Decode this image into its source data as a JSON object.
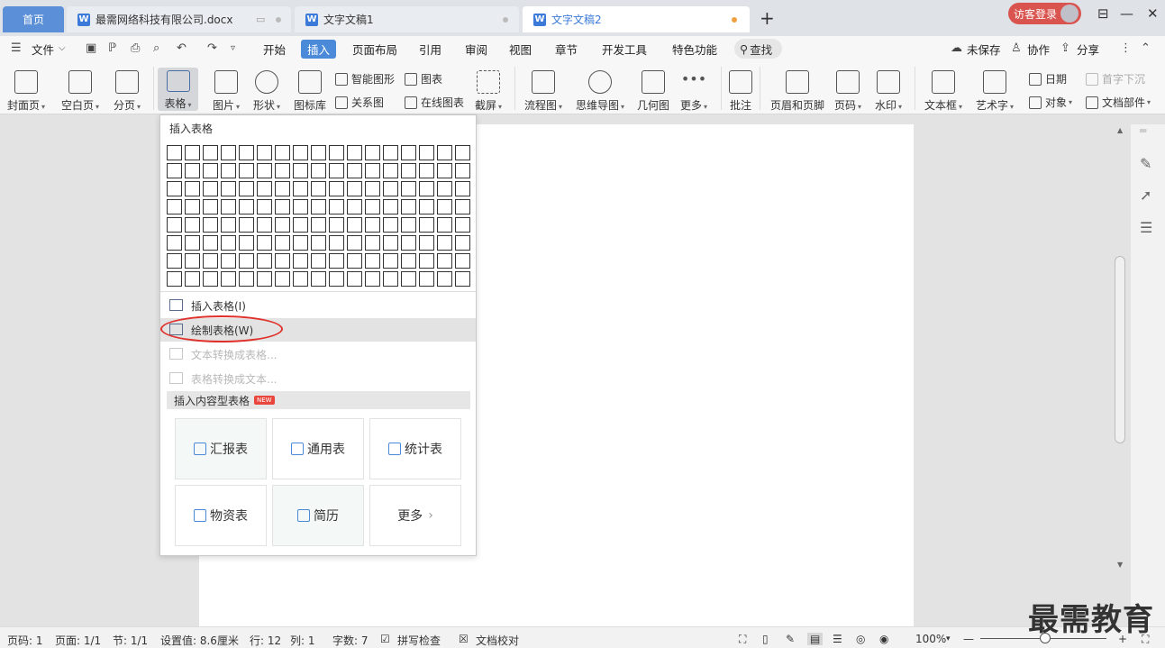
{
  "tabs": {
    "home": "首页",
    "doc1": "最需网络科技有限公司.docx",
    "doc2": "文字文稿1",
    "doc3": "文字文稿2",
    "new_tab": "+"
  },
  "login": "访客登录",
  "window_controls": [
    "⊟",
    "—",
    "☐",
    "✕"
  ],
  "menu": {
    "file": "文件",
    "items": [
      "开始",
      "插入",
      "页面布局",
      "引用",
      "审阅",
      "视图",
      "章节",
      "开发工具",
      "特色功能"
    ],
    "active": "插入",
    "search": "查找",
    "unsaved": "未保存",
    "collab": "协作",
    "share": "分享"
  },
  "ribbon": {
    "cover": "封面页",
    "blank": "空白页",
    "pagebreak": "分页",
    "table": "表格",
    "picture": "图片",
    "shape": "形状",
    "iconlib": "图标库",
    "smartart": "智能图形",
    "chart": "图表",
    "relation": "关系图",
    "onlinechart": "在线图表",
    "screenshot": "截屏",
    "flowchart": "流程图",
    "mindmap": "思维导图",
    "geometry": "几何图",
    "more": "更多",
    "comment": "批注",
    "headerfooter": "页眉和页脚",
    "pagenum": "页码",
    "watermark": "水印",
    "textbox": "文本框",
    "wordart": "艺术字",
    "date": "日期",
    "object": "对象",
    "dropcap": "首字下沉",
    "docparts": "文档部件"
  },
  "dropdown": {
    "title": "插入表格",
    "grid_rows": 8,
    "grid_cols": 17,
    "insert_table": "插入表格(I)",
    "draw_table": "绘制表格(W)",
    "text_to_table": "文本转换成表格...",
    "table_to_text": "表格转换成文本...",
    "content_section": "插入内容型表格",
    "new_badge": "NEW",
    "templates": [
      "汇报表",
      "通用表",
      "统计表",
      "物资表",
      "简历",
      "更多"
    ]
  },
  "status": {
    "page": "页码: 1",
    "pages": "页面: 1/1",
    "section": "节: 1/1",
    "setting": "设置值: 8.6厘米",
    "row": "行: 12",
    "col": "列: 1",
    "words": "字数: 7",
    "spell": "拼写检查",
    "proof": "文档校对",
    "zoom": "100%"
  },
  "brand_watermark": "最需教育"
}
